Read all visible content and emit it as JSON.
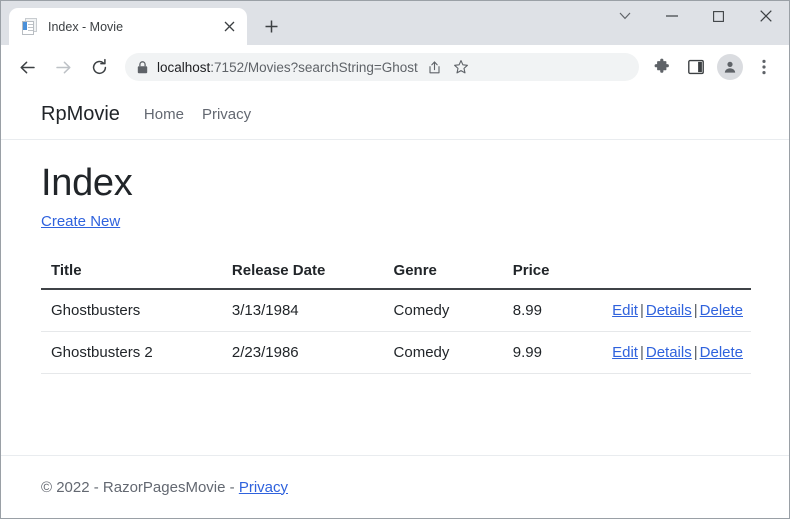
{
  "browser": {
    "tab": {
      "title": "Index - Movie",
      "favicon": "document-icon",
      "close_label": "✕"
    },
    "new_tab_label": "+",
    "window_controls": {
      "tab_search": "∨",
      "minimize": "—",
      "maximize": "□",
      "close": "✕"
    },
    "toolbar": {
      "back": "back-arrow-icon",
      "forward": "forward-arrow-icon",
      "reload": "reload-icon",
      "security_icon": "lock-icon",
      "url_host": "localhost",
      "url_rest": ":7152/Movies?searchString=Ghost",
      "url_full": "localhost:7152/Movies?searchString=Ghost",
      "share": "share-icon",
      "bookmark": "star-icon",
      "extensions": "puzzle-icon",
      "side_panel": "side-panel-icon",
      "profile": "profile-avatar-icon",
      "menu": "three-dot-menu-icon"
    }
  },
  "site": {
    "brand": "RpMovie",
    "nav": [
      {
        "label": "Home"
      },
      {
        "label": "Privacy"
      }
    ]
  },
  "page": {
    "title": "Index",
    "create_new": "Create New",
    "table": {
      "columns": [
        "Title",
        "Release Date",
        "Genre",
        "Price",
        ""
      ],
      "rows": [
        {
          "title": "Ghostbusters",
          "release_date": "3/13/1984",
          "genre": "Comedy",
          "price": "8.99",
          "edit": "Edit",
          "details": "Details",
          "delete": "Delete",
          "sep1": "|",
          "sep2": "|"
        },
        {
          "title": "Ghostbusters 2",
          "release_date": "2/23/1986",
          "genre": "Comedy",
          "price": "9.99",
          "edit": "Edit",
          "details": "Details",
          "delete": "Delete",
          "sep1": "|",
          "sep2": "|"
        }
      ]
    }
  },
  "footer": {
    "copyright": "© 2022 - RazorPagesMovie - ",
    "privacy": "Privacy"
  },
  "colors": {
    "link": "#2f62dd",
    "tabstrip": "#dee1e6",
    "text": "#212529",
    "muted": "#636871"
  }
}
